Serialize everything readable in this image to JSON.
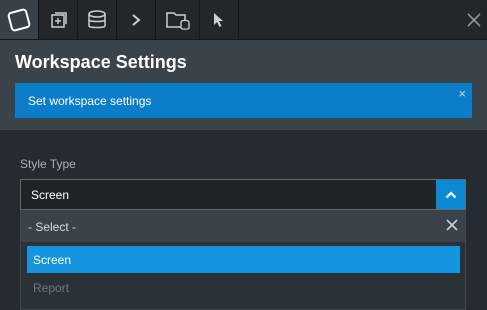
{
  "toolbar": {
    "items": [
      {
        "icon": "cube-outline-icon",
        "active": true
      },
      {
        "icon": "add-layer-icon"
      },
      {
        "icon": "database-icon"
      },
      {
        "icon": "chevron-right-icon"
      },
      {
        "icon": "folder-database-icon"
      },
      {
        "icon": "cursor-pointer-icon"
      }
    ],
    "close_icon": "close-icon"
  },
  "header": {
    "title": "Workspace Settings"
  },
  "info_banner": {
    "text": "Set workspace settings",
    "close_glyph": "×"
  },
  "style_type": {
    "label": "Style Type",
    "value": "Screen",
    "dropdown": {
      "placeholder": "- Select -",
      "options": [
        {
          "label": "Screen",
          "state": "selected"
        },
        {
          "label": "Report",
          "state": "disabled"
        }
      ]
    }
  },
  "colors": {
    "accent": "#0d8ad6",
    "banner": "#0c7dc8",
    "selected": "#1595dd"
  }
}
